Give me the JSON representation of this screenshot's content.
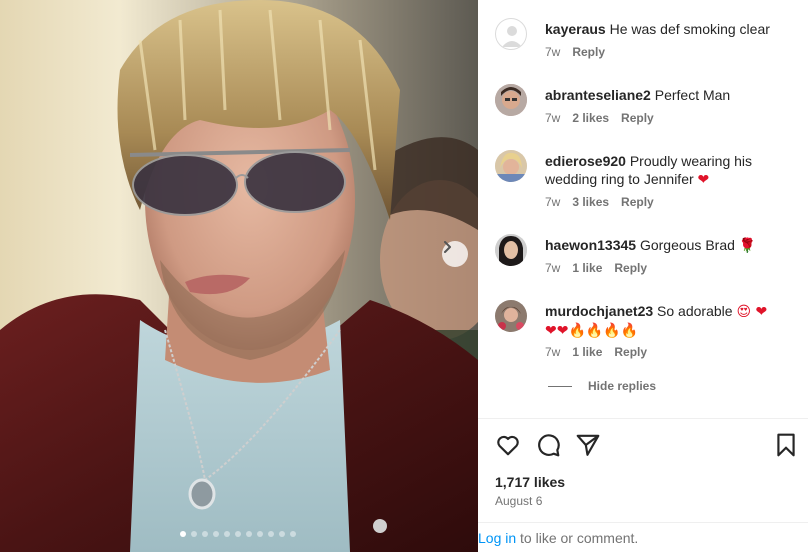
{
  "post": {
    "photo_subject": "man-with-sunglasses-photo",
    "carousel_dot_count": 11,
    "active_dot": 0
  },
  "comments": [
    {
      "username": "kayeraus",
      "text": "He was def smoking clear",
      "time": "7w",
      "likes": "",
      "reply": "Reply",
      "avatar": "default-avatar"
    },
    {
      "username": "abranteseliane2",
      "text": "Perfect Man",
      "time": "7w",
      "likes": "2 likes",
      "reply": "Reply",
      "avatar": "woman-glasses"
    },
    {
      "username": "edierose920",
      "text": "Proudly wearing his wedding ring to Jennifer",
      "text_emoji": "❤",
      "time": "7w",
      "likes": "3 likes",
      "reply": "Reply",
      "avatar": "blonde-woman"
    },
    {
      "username": "haewon13345",
      "text": "Gorgeous Brad",
      "text_emoji": "🌹",
      "time": "7w",
      "likes": "1 like",
      "reply": "Reply",
      "avatar": "dark-hair-woman"
    },
    {
      "username": "murdochjanet23",
      "text": "So adorable",
      "text_emoji": "😍 ❤",
      "line2_hearts": "❤❤",
      "line2_fires": "🔥🔥🔥🔥",
      "time": "7w",
      "likes": "1 like",
      "reply": "Reply",
      "avatar": "woman-flowers"
    }
  ],
  "hide_replies": "Hide replies",
  "actions": {
    "like_icon": "heart-outline-icon",
    "comment_icon": "comment-bubble-icon",
    "share_icon": "paper-plane-icon",
    "save_icon": "bookmark-icon"
  },
  "likes_count": "1,717 likes",
  "post_date": "August 6",
  "login": {
    "link_text": "Log in",
    "rest_text": " to like or comment."
  },
  "colors": {
    "link": "#0095f6",
    "muted": "#737373",
    "text": "#262626",
    "heart": "#e0142a"
  }
}
